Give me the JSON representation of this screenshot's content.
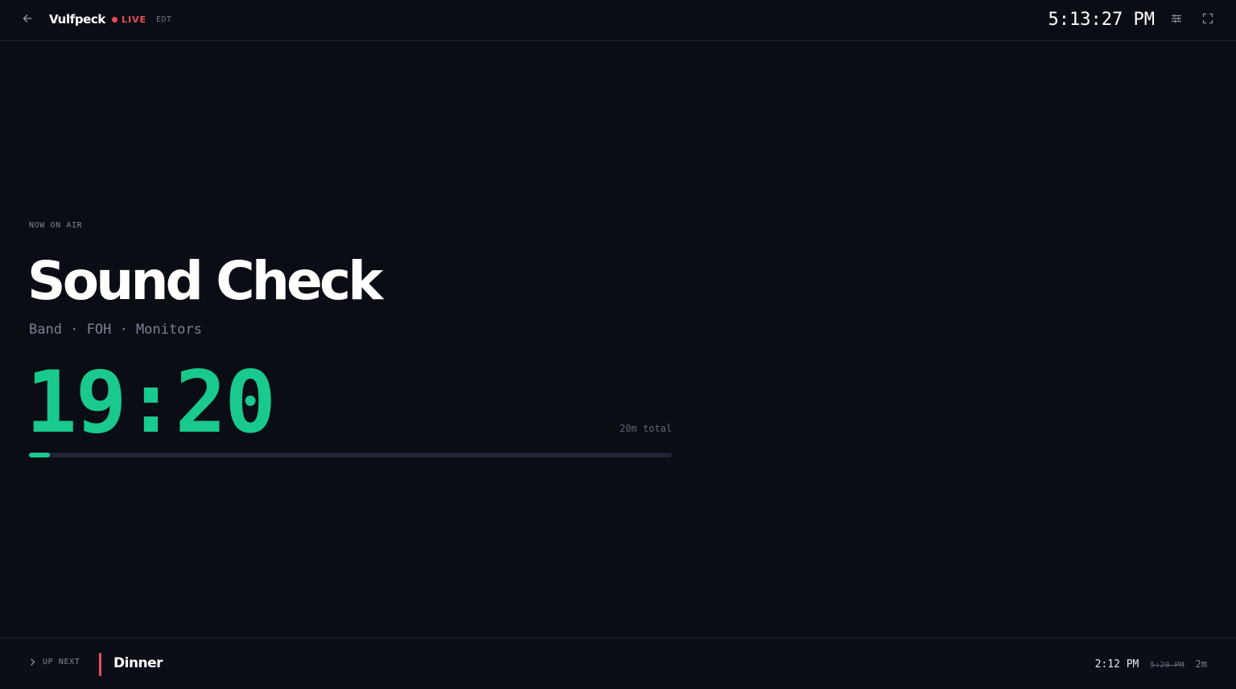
{
  "header": {
    "brand": "Vulfpeck",
    "status": "LIVE",
    "timezone": "EDT",
    "clock": "5:13:27 PM",
    "icons": {
      "back": "arrow-left-icon",
      "settings": "sliders-icon",
      "fullscreen": "fullscreen-icon"
    }
  },
  "current": {
    "eyebrow": "NOW ON AIR",
    "title": "Sound Check",
    "subtitle": "Band · FOH · Monitors",
    "countdown": "19:20",
    "total": "20m total",
    "progress_percent": 3.3
  },
  "next": {
    "label": "UP NEXT",
    "title": "Dinner",
    "start_time": "2:12 PM",
    "original_time": "5:20 PM",
    "duration": "2m"
  },
  "colors": {
    "background": "#0a0d14",
    "accent_green": "#19c98e",
    "live_red": "#ef4d56"
  }
}
